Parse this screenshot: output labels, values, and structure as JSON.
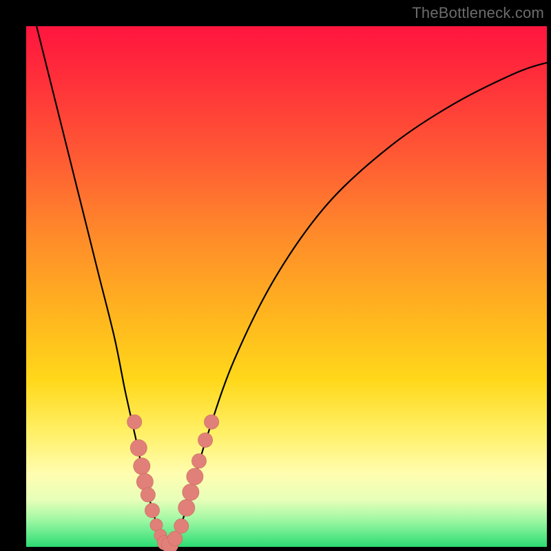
{
  "watermark": "TheBottleneck.com",
  "colors": {
    "frame": "#000000",
    "curve_stroke": "#000000",
    "marker_fill": "#e08078",
    "marker_stroke": "#c96a62"
  },
  "chart_data": {
    "type": "line",
    "title": "",
    "xlabel": "",
    "ylabel": "",
    "xlim": [
      0,
      100
    ],
    "ylim": [
      0,
      100
    ],
    "grid": false,
    "series": [
      {
        "name": "bottleneck-curve",
        "x": [
          2,
          5,
          8,
          11,
          14,
          17,
          19,
          21,
          22.5,
          24,
          25.2,
          26.3,
          27.2,
          28,
          30,
          32,
          35,
          40,
          48,
          58,
          70,
          82,
          94,
          100
        ],
        "y": [
          100,
          88,
          76,
          64,
          52,
          40,
          30,
          21,
          14,
          8,
          4,
          1.5,
          0.3,
          1,
          5,
          12,
          22,
          36,
          52,
          66,
          77,
          85,
          91,
          93
        ]
      }
    ],
    "markers": [
      {
        "name": "pill",
        "x": 20.8,
        "y": 24.0,
        "r": 1.4
      },
      {
        "name": "pill",
        "x": 21.6,
        "y": 19.0,
        "r": 1.6
      },
      {
        "name": "pill",
        "x": 22.2,
        "y": 15.5,
        "r": 1.6
      },
      {
        "name": "pill",
        "x": 22.8,
        "y": 12.5,
        "r": 1.6
      },
      {
        "name": "pill",
        "x": 23.4,
        "y": 10.0,
        "r": 1.4
      },
      {
        "name": "pill",
        "x": 24.2,
        "y": 7.0,
        "r": 1.4
      },
      {
        "name": "pill",
        "x": 25.0,
        "y": 4.2,
        "r": 1.2
      },
      {
        "name": "pill",
        "x": 25.8,
        "y": 2.2,
        "r": 1.2
      },
      {
        "name": "pill",
        "x": 26.6,
        "y": 0.8,
        "r": 1.4
      },
      {
        "name": "pill",
        "x": 27.6,
        "y": 0.4,
        "r": 1.6
      },
      {
        "name": "pill",
        "x": 28.6,
        "y": 1.6,
        "r": 1.4
      },
      {
        "name": "pill",
        "x": 29.8,
        "y": 4.0,
        "r": 1.4
      },
      {
        "name": "pill",
        "x": 30.8,
        "y": 7.5,
        "r": 1.6
      },
      {
        "name": "pill",
        "x": 31.6,
        "y": 10.5,
        "r": 1.6
      },
      {
        "name": "pill",
        "x": 32.4,
        "y": 13.5,
        "r": 1.6
      },
      {
        "name": "pill",
        "x": 33.2,
        "y": 16.5,
        "r": 1.4
      },
      {
        "name": "pill",
        "x": 34.4,
        "y": 20.5,
        "r": 1.4
      },
      {
        "name": "pill",
        "x": 35.6,
        "y": 24.0,
        "r": 1.4
      }
    ]
  }
}
